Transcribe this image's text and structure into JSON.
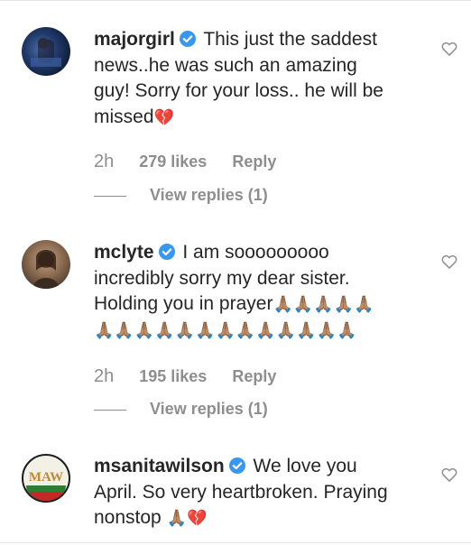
{
  "comments": [
    {
      "username": "majorgirl",
      "text_lines": [
        "This just the saddest",
        "news..he was such an amazing",
        "guy! Sorry for your loss.. he will be",
        "missed"
      ],
      "emojis": [
        "💔"
      ],
      "time": "2h",
      "likes": "279 likes",
      "reply": "Reply",
      "view_replies": "View replies (1)",
      "avatar_icon": "profile-photo-icon"
    },
    {
      "username": "mclyte",
      "text_lines": [
        "I am sooooooooo",
        "incredibly sorry my dear sister.",
        "Holding you in prayer"
      ],
      "emoji_row_1": "🙏🏽🙏🏽🙏🏽🙏🏽🙏🏽",
      "emoji_row_2": "🙏🏽🙏🏽🙏🏽🙏🏽🙏🏽🙏🏽🙏🏽🙏🏽🙏🏽🙏🏽🙏🏽🙏🏽🙏🏽",
      "time": "2h",
      "likes": "195 likes",
      "reply": "Reply",
      "view_replies": "View replies (1)",
      "avatar_icon": "profile-photo-icon"
    },
    {
      "username": "msanitawilson",
      "text_lines": [
        "We love you",
        "April. So very heartbroken. Praying",
        "nonstop"
      ],
      "emojis": [
        "🙏🏽",
        "💔"
      ],
      "avatar_label": "MAW",
      "avatar_icon": "logo-avatar-icon"
    }
  ],
  "colors": {
    "text": "#262626",
    "meta": "#8e8e8e",
    "verified": "#3897f0",
    "divider": "#e6e6e6"
  }
}
